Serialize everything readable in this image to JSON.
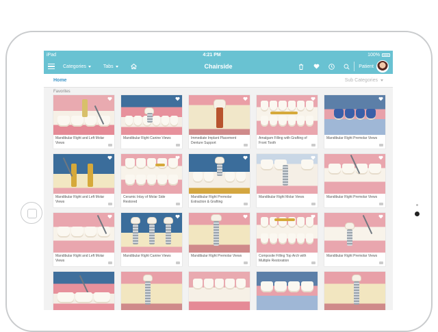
{
  "status": {
    "carrier": "iPad",
    "time": "4:21 PM",
    "battery": "100%"
  },
  "nav": {
    "categories_label": "Categories",
    "tabs_label": "Tabs",
    "title": "Chairside",
    "patient_label": "Patient"
  },
  "subbar": {
    "home_label": "Home",
    "subcategories_label": "Sub Categories"
  },
  "section": {
    "label": "Favorites"
  },
  "cards": [
    {
      "caption": "Mandibular Right and Left Molar Views"
    },
    {
      "caption": "Mandibular Right Canine Views"
    },
    {
      "caption": "Immediate Implant Placement Denture Support"
    },
    {
      "caption": "Amalgam Filling with Grafting of Front Tooth"
    },
    {
      "caption": "Mandibular Right Premolar Views"
    },
    {
      "caption": "Mandibular Right and Left Molar Views"
    },
    {
      "caption": "Ceramic Inlay of Molar Side Restored"
    },
    {
      "caption": "Mandibular Right Premolar Extraction & Grafting"
    },
    {
      "caption": "Mandibular Right Molar Views"
    },
    {
      "caption": "Mandibular Right Premolar Views"
    },
    {
      "caption": "Mandibular Right and Left Molar Views"
    },
    {
      "caption": "Mandibular Right Canine Views"
    },
    {
      "caption": "Mandibular Right Premolar Views"
    },
    {
      "caption": "Composite Filling Top Arch with Multiple Restoration"
    },
    {
      "caption": "Mandibular Right Premolar Views"
    }
  ],
  "colors": {
    "accent": "#69c2d2",
    "link": "#3d95c8"
  }
}
